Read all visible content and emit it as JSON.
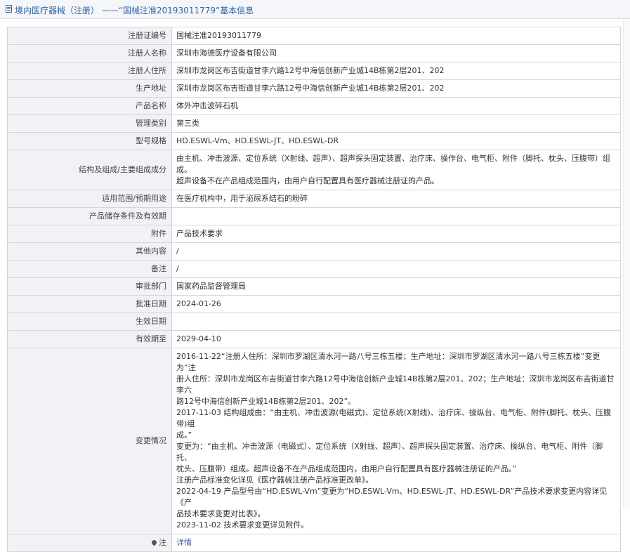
{
  "header": {
    "title": "境内医疗器械（注册） ——“国械注准20193011779”基本信息"
  },
  "rows": {
    "reg_no": {
      "label": "注册证编号",
      "value": "国械注准20193011779"
    },
    "registrant": {
      "label": "注册人名称",
      "value": "深圳市海德医疗设备有限公司"
    },
    "registrant_addr": {
      "label": "注册人住所",
      "value": "深圳市龙岗区布吉街道甘李六路12号中海信创新产业城14B栋第2层201、202"
    },
    "production_addr": {
      "label": "生产地址",
      "value": "深圳市龙岗区布吉街道甘李六路12号中海信创新产业城14B栋第2层201、202"
    },
    "product_name": {
      "label": "产品名称",
      "value": "体外冲击波碎石机"
    },
    "category": {
      "label": "管理类别",
      "value": "第三类"
    },
    "model": {
      "label": "型号规格",
      "value": "HD.ESWL-Vm、HD.ESWL-JT、HD.ESWL-DR"
    },
    "structure": {
      "label": "结构及组成/主要组成成分",
      "lines": [
        "由主机、冲击波源、定位系统（X射线、超声）、超声探头固定装置、治疗床、操作台、电气柜、附件（脚托、枕头、压腹带）组成。",
        "超声设备不在产品组成范围内，由用户自行配置具有医疗器械注册证的产品。"
      ]
    },
    "scope": {
      "label": "适用范围/预期用途",
      "value": "在医疗机构中，用于泌尿系结石的粉碎"
    },
    "storage": {
      "label": "产品储存条件及有效期",
      "value": ""
    },
    "attachment": {
      "label": "附件",
      "value": "产品技术要求"
    },
    "other": {
      "label": "其他内容",
      "value": "/"
    },
    "remark": {
      "label": "备注",
      "value": "/"
    },
    "dept": {
      "label": "审批部门",
      "value": "国家药品监督管理局"
    },
    "approve_date": {
      "label": "批准日期",
      "value": "2024-01-26"
    },
    "effective_date": {
      "label": "生效日期",
      "value": ""
    },
    "expiry": {
      "label": "有效期至",
      "value": "2029-04-10"
    },
    "changes": {
      "label": "变更情况",
      "lines": [
        "2016-11-22“注册人住所：深圳市罗湖区清水河一路八号三栋五楼；生产地址：深圳市罗湖区清水河一路八号三栋五楼”变更为“注",
        "册人住所：深圳市龙岗区布吉街道甘李六路12号中海信创新产业城14B栋第2层201、202；生产地址：深圳市龙岗区布吉街道甘李六",
        "路12号中海信创新产业城14B栋第2层201、202”。",
        "2017-11-03 结构组成由：“由主机、冲击波源(电磁式)、定位系统(X射线)、治疗床、操纵台、电气柜、附件(脚托、枕头、压腹带)组",
        "成。”",
        "变更为：“由主机、冲击波源（电磁式）、定位系统（X射线、超声）、超声探头固定装置、治疗床、操纵台、电气柜、附件（脚托、",
        "枕头、压腹带）组成。超声设备不在产品组成范围内，由用户自行配置具有医疗器械注册证的产品。”",
        "注册产品标准变化详见《医疗器械注册产品标准更改单》。",
        "2022-04-19 产品型号由“HD.ESWL-Vm”变更为“HD.ESWL-Vm、HD.ESWL-JT、HD.ESWL-DR”产品技术要求变更内容详见《产",
        "品技术要求变更对比表》。",
        "2023-11-02 技术要求变更详见附件。"
      ]
    },
    "note": {
      "label": "注",
      "link": "详情",
      "icon": "pin-icon"
    }
  },
  "colors": {
    "accent": "#2f63a8",
    "label_bg": "#f1f2f5",
    "border": "#d6d6d6"
  }
}
